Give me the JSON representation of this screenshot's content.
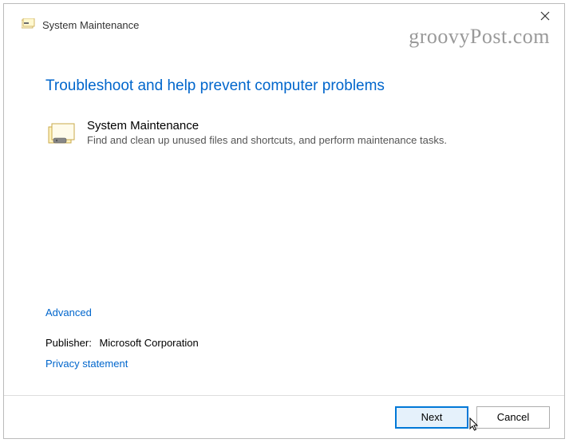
{
  "titlebar": {
    "title": "System Maintenance"
  },
  "watermark": "groovyPost.com",
  "main": {
    "heading": "Troubleshoot and help prevent computer problems",
    "item": {
      "title": "System Maintenance",
      "description": "Find and clean up unused files and shortcuts, and perform maintenance tasks."
    },
    "advanced_label": "Advanced",
    "publisher_label": "Publisher:",
    "publisher_value": "Microsoft Corporation",
    "privacy_label": "Privacy statement"
  },
  "buttons": {
    "next": "Next",
    "cancel": "Cancel"
  }
}
